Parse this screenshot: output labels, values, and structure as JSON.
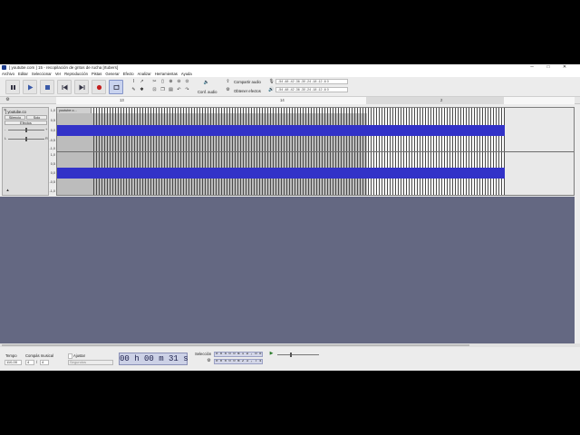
{
  "window": {
    "title": "[ youtube.com ] 15 - recopilación de gritos de rucha [rtubers]",
    "controls": [
      "─",
      "□",
      "✕"
    ]
  },
  "menu": [
    "Archivo",
    "Editar",
    "Seleccionar",
    "Ver",
    "Reproducción",
    "Pistas",
    "Generar",
    "Efecto",
    "Analizar",
    "Herramientas",
    "Ayuda"
  ],
  "toolbar": {
    "pause_icon": "pause-icon",
    "play_icon": "play-icon",
    "stop_icon": "stop-icon",
    "skip_start_icon": "skip-start-icon",
    "skip_end_icon": "skip-end-icon",
    "record_icon": "record-icon",
    "loop_icon": "loop-icon",
    "audio_setup": "Conf. audio",
    "share_audio": "Compartir audio",
    "get_effects": "Obtener efectos",
    "meter_scale": "-54 -48 -42 -36 -30 -24 -18 -12 -6 0"
  },
  "ruler": {
    "ticks": [
      "13",
      "14",
      "2"
    ]
  },
  "track": {
    "name": "[ youtube.co",
    "mute": "Silencio",
    "solo": "Solo",
    "effects": "Efectos",
    "gain_minus": "-",
    "gain_plus": "+",
    "pan_left": "L",
    "pan_right": "R",
    "clip_name": "youtube.c...",
    "vscale": [
      "1,0",
      "0,5",
      "0,0",
      "-0,5",
      "-1,0",
      "1,0",
      "0,5",
      "0,0",
      "-0,5",
      "-1,0"
    ]
  },
  "bottom": {
    "tempo_label": "Tempo",
    "tempo_value": "110,00",
    "timesig_label": "Compás musical",
    "timesig_num": "4",
    "timesig_sep": "/",
    "timesig_den": "4",
    "snap_label": "Ajustar",
    "snap_unit": "Segundos",
    "time_display": "00 h 00 m 31 s",
    "selection_label": "Selección",
    "sel_start": "0 0 h 0 0 m 1 9 , 0 0 s",
    "sel_end": "0 0 h 0 0 m 2 3 , 7 4 s"
  }
}
